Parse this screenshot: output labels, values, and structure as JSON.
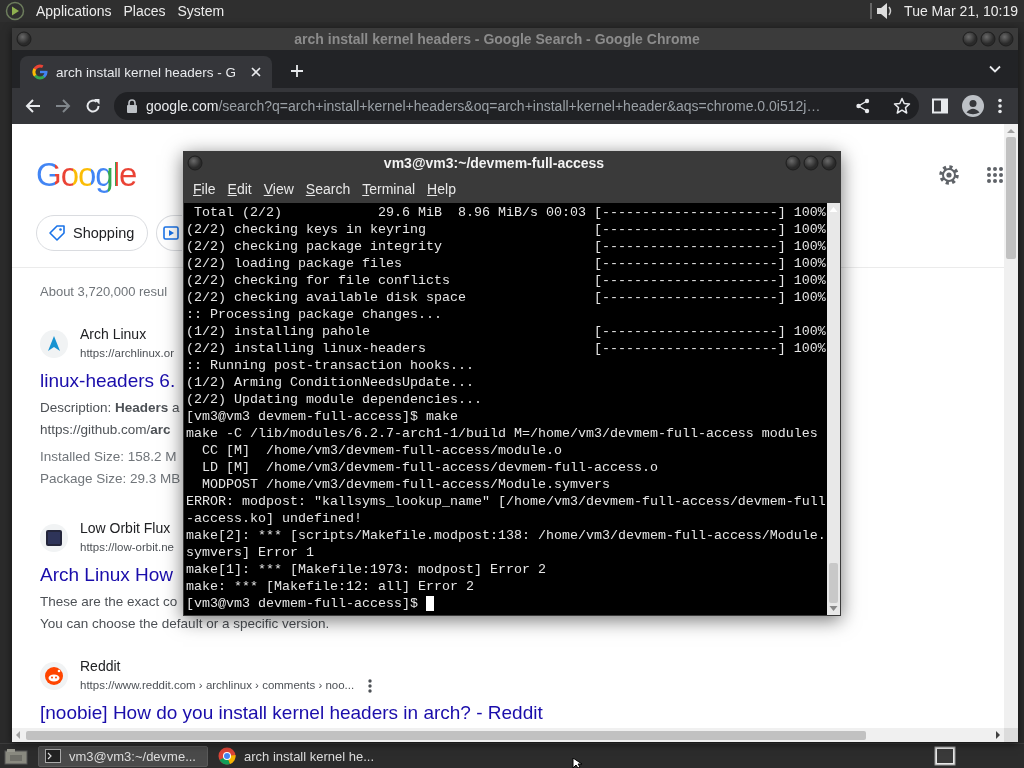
{
  "top_panel": {
    "menus": [
      "Applications",
      "Places",
      "System"
    ],
    "clock": "Tue Mar 21, 10:19"
  },
  "browser": {
    "window_title": "arch install kernel headers - Google Search - Google Chrome",
    "tabs": [
      {
        "title": "arch install kernel headers - G",
        "selected": true
      }
    ],
    "url_host": "google.com",
    "url_path": "/search?q=arch+install+kernel+headers&oq=arch+install+kernel+header&aqs=chrome.0.0i512j…",
    "page": {
      "logo": "Google",
      "chips": [
        {
          "kind": "tag",
          "label": "Shopping"
        },
        {
          "kind": "video"
        }
      ],
      "result_stats": "About 3,720,000 resul",
      "results": [
        {
          "kind": "arch",
          "site": "Arch Linux",
          "url": "https://archlinux.or",
          "title": "linux-headers 6.",
          "snippets": [
            "Description: **Headers** a",
            "https://github.com/**arc**"
          ],
          "details": [
            "Installed Size: 158.2 M",
            "Package Size: 29.3 MB"
          ],
          "more_button": false
        },
        {
          "kind": "square",
          "site": "Low Orbit Flux",
          "url": "https://low-orbit.ne",
          "title": "Arch Linux How",
          "snippets": [
            "These are the exact co",
            "You can choose the default or a specific version."
          ],
          "more_button": false
        },
        {
          "kind": "reddit",
          "site": "Reddit",
          "url": "https://www.reddit.com › archlinux › comments › noo...",
          "title": "[noobie] How do you install kernel headers in arch? - Reddit",
          "more_button": true
        }
      ]
    }
  },
  "terminal": {
    "title": "vm3@vm3:~/devmem-full-access",
    "menus": [
      "File",
      "Edit",
      "View",
      "Search",
      "Terminal",
      "Help"
    ],
    "lines": [
      {
        "text": " Total (2/2)            29.6 MiB  8.96 MiB/s 00:03",
        "progress": "[----------------------] 100%"
      },
      {
        "text": "(2/2) checking keys in keyring",
        "progress": "[----------------------] 100%"
      },
      {
        "text": "(2/2) checking package integrity",
        "progress": "[----------------------] 100%"
      },
      {
        "text": "(2/2) loading package files",
        "progress": "[----------------------] 100%"
      },
      {
        "text": "(2/2) checking for file conflicts",
        "progress": "[----------------------] 100%"
      },
      {
        "text": "(2/2) checking available disk space",
        "progress": "[----------------------] 100%"
      },
      {
        "text": ":: Processing package changes..."
      },
      {
        "text": "(1/2) installing pahole",
        "progress": "[----------------------] 100%"
      },
      {
        "text": "(2/2) installing linux-headers",
        "progress": "[----------------------] 100%"
      },
      {
        "text": ":: Running post-transaction hooks..."
      },
      {
        "text": "(1/2) Arming ConditionNeedsUpdate..."
      },
      {
        "text": "(2/2) Updating module dependencies..."
      },
      {
        "text": "[vm3@vm3 devmem-full-access]$ make"
      },
      {
        "text": "make -C /lib/modules/6.2.7-arch1-1/build M=/home/vm3/devmem-full-access modules"
      },
      {
        "text": "  CC [M]  /home/vm3/devmem-full-access/module.o"
      },
      {
        "text": "  LD [M]  /home/vm3/devmem-full-access/devmem-full-access.o"
      },
      {
        "text": "  MODPOST /home/vm3/devmem-full-access/Module.symvers"
      },
      {
        "text": "ERROR: modpost: \"kallsyms_lookup_name\" [/home/vm3/devmem-full-access/devmem-full"
      },
      {
        "text": "-access.ko] undefined!"
      },
      {
        "text": "make[2]: *** [scripts/Makefile.modpost:138: /home/vm3/devmem-full-access/Module."
      },
      {
        "text": "symvers] Error 1"
      },
      {
        "text": "make[1]: *** [Makefile:1973: modpost] Error 2"
      },
      {
        "text": "make: *** [Makefile:12: all] Error 2"
      },
      {
        "text": "[vm3@vm3 devmem-full-access]$ ",
        "cursor": true
      }
    ]
  },
  "taskbar": {
    "tasks": [
      {
        "kind": "terminal",
        "label": "vm3@vm3:~/devme...",
        "selected": true
      },
      {
        "kind": "browser",
        "label": "arch install kernel he...",
        "selected": false
      }
    ]
  }
}
